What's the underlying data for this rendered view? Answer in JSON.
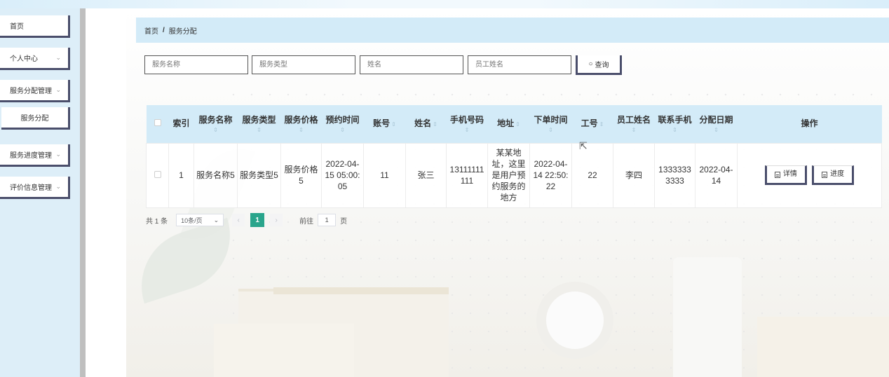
{
  "sidebar": {
    "items": [
      {
        "label": "首页",
        "has_chevron": false
      },
      {
        "label": "个人中心",
        "has_chevron": true
      },
      {
        "label": "服务分配管理",
        "has_chevron": true
      },
      {
        "label": "服务分配",
        "has_chevron": false,
        "sub": true
      },
      {
        "label": "服务进度管理",
        "has_chevron": true
      },
      {
        "label": "评价信息管理",
        "has_chevron": true
      }
    ]
  },
  "breadcrumb": {
    "home": "首页",
    "separator": "/",
    "current": "服务分配"
  },
  "search": {
    "service_name_placeholder": "服务名称",
    "service_type_placeholder": "服务类型",
    "name_placeholder": "姓名",
    "staff_name_placeholder": "员工姓名",
    "query_label": "查询"
  },
  "table": {
    "headers": [
      "索引",
      "服务名称",
      "服务类型",
      "服务价格",
      "预约时间",
      "账号",
      "姓名",
      "手机号码",
      "地址",
      "下单时间",
      "工号",
      "员工姓名",
      "联系手机",
      "分配日期",
      "操作"
    ],
    "rows": [
      {
        "index": "1",
        "service_name": "服务名称5",
        "service_type": "服务类型5",
        "service_price": "服务价格5",
        "appointment_time": "2022-04-15 05:00:05",
        "account": "11",
        "name": "张三",
        "phone": "13111111111",
        "address": "某某地址，这里是用户预约服务的地方",
        "order_time": "2022-04-14 22:50:22",
        "staff_no": "22",
        "staff_name": "李四",
        "contact_phone": "13333333333",
        "assign_date": "2022-04-14",
        "detail_label": "详情",
        "progress_label": "进度"
      }
    ]
  },
  "pager": {
    "total": "共 1 条",
    "page_size": "10条/页",
    "current_page": "1",
    "goto_prefix": "前往",
    "goto_value": "1",
    "goto_suffix": "页"
  },
  "colors": {
    "accent": "#d3ebf8",
    "button_border": "#4a4e6b",
    "pager_active": "#2aa58c"
  }
}
